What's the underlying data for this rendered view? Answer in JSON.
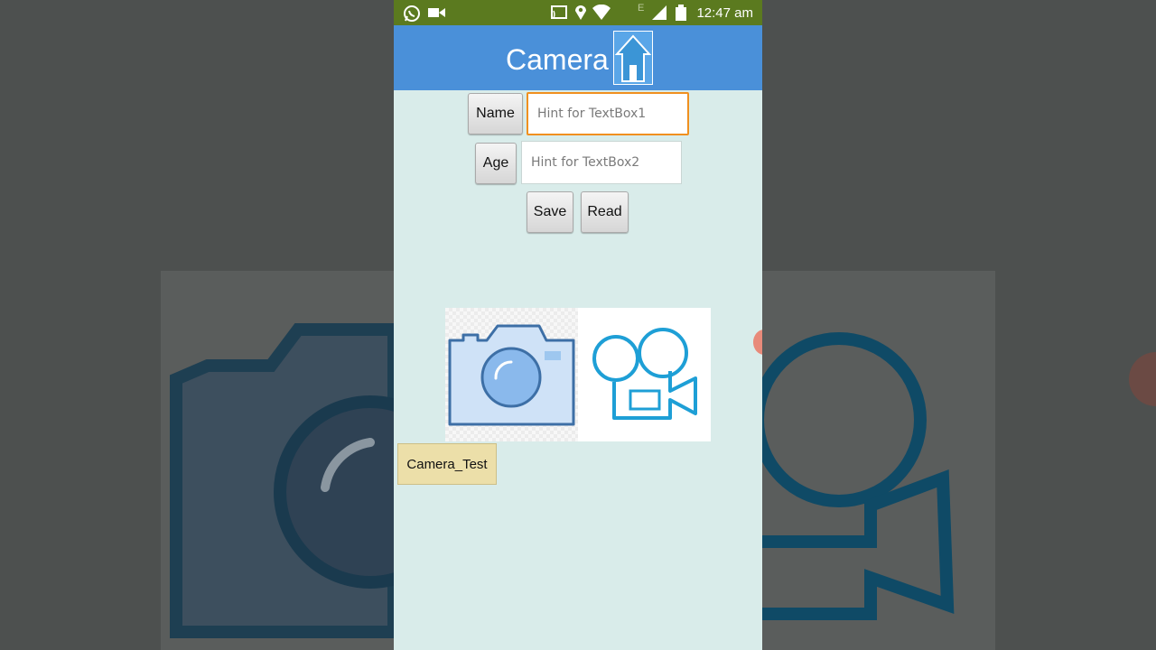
{
  "status_bar": {
    "time": "12:47 am",
    "network_letter": "E",
    "icons": [
      "whatsapp-icon",
      "video-camera-icon",
      "cast-icon",
      "location-icon",
      "wifi-icon",
      "signal-icon",
      "battery-icon"
    ]
  },
  "app": {
    "title": "Camera",
    "logo_icon": "house-logo-icon",
    "accent_color": "#4a90d9",
    "status_color": "#5b7a1f",
    "background_color": "#d9ecea"
  },
  "form": {
    "name_label": "Name",
    "name_placeholder": "Hint for TextBox1",
    "name_value": "",
    "age_label": "Age",
    "age_placeholder": "Hint for TextBox2",
    "age_value": "",
    "save_label": "Save",
    "read_label": "Read"
  },
  "images": {
    "camera_icon": "photo-camera-icon",
    "video_icon": "movie-camera-icon"
  },
  "camera_test_label": "Camera_Test"
}
